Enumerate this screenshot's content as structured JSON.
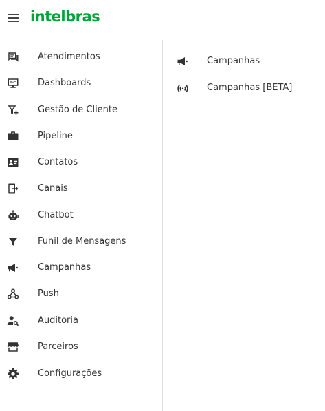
{
  "brand": {
    "logo_text": "intelbras",
    "logo_color": "#00a335"
  },
  "header": {
    "menu_icon": "hamburger-icon"
  },
  "sidebar": {
    "items": [
      {
        "label": "Atendimentos",
        "icon": "chat-icon"
      },
      {
        "label": "Dashboards",
        "icon": "monitor-icon"
      },
      {
        "label": "Gestão de Cliente",
        "icon": "filter-add-icon"
      },
      {
        "label": "Pipeline",
        "icon": "briefcase-icon"
      },
      {
        "label": "Contatos",
        "icon": "contact-card-icon"
      },
      {
        "label": "Canais",
        "icon": "mobile-arrow-icon"
      },
      {
        "label": "Chatbot",
        "icon": "robot-icon"
      },
      {
        "label": "Funil de Mensagens",
        "icon": "funnel-icon"
      },
      {
        "label": "Campanhas",
        "icon": "megaphone-icon"
      },
      {
        "label": "Push",
        "icon": "webhook-icon"
      },
      {
        "label": "Auditoria",
        "icon": "person-search-icon"
      },
      {
        "label": "Parceiros",
        "icon": "storefront-icon"
      },
      {
        "label": "Configurações",
        "icon": "gear-icon"
      }
    ]
  },
  "submenu": {
    "items": [
      {
        "label": "Campanhas",
        "icon": "megaphone-icon"
      },
      {
        "label": "Campanhas [BETA]",
        "icon": "broadcast-icon"
      }
    ]
  },
  "colors": {
    "icon": "#333333",
    "text": "#333333",
    "divider": "#e0e0e0"
  }
}
